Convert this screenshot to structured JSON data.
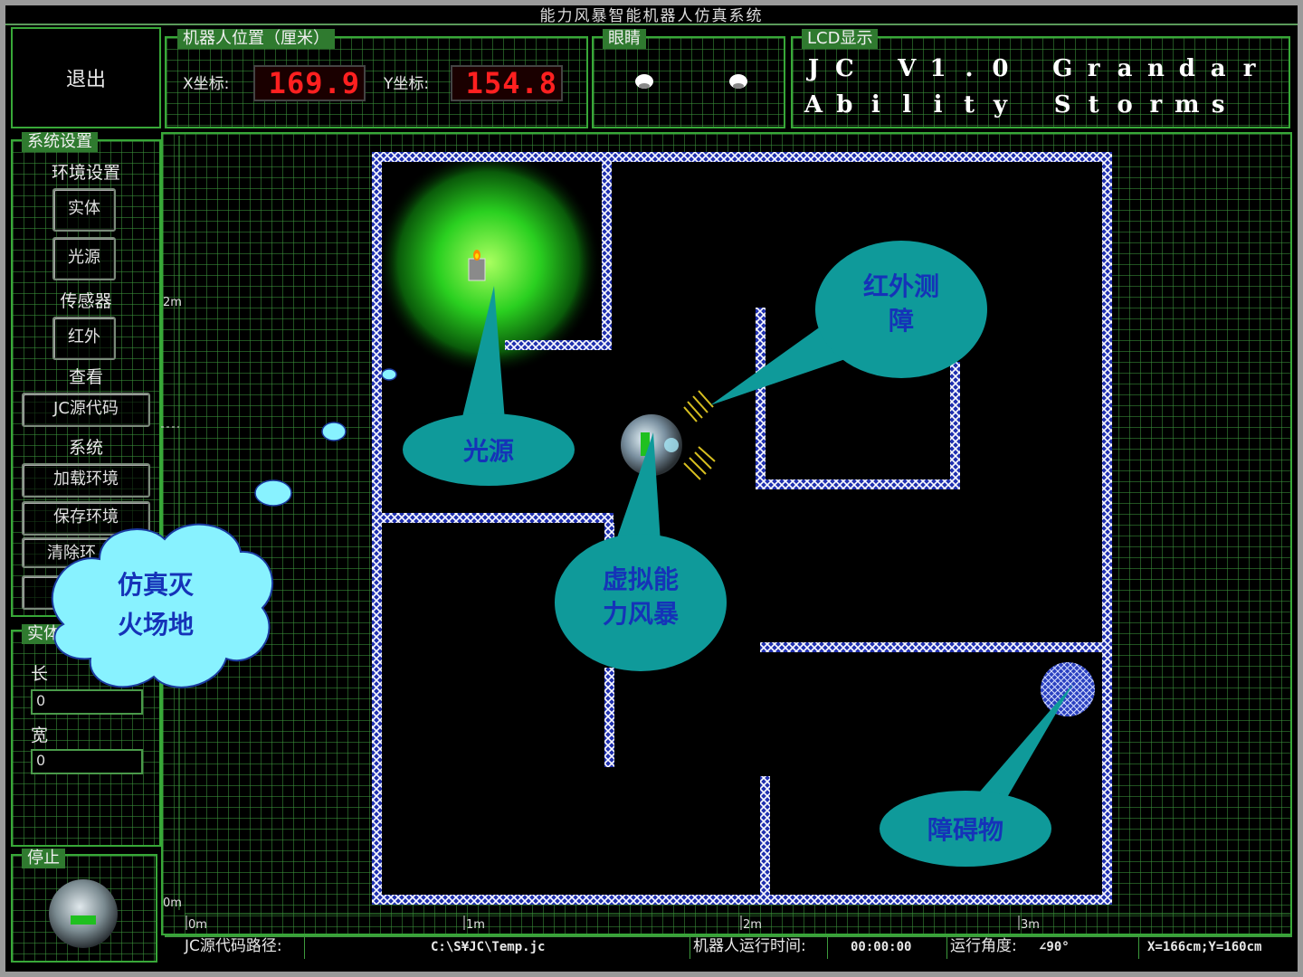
{
  "window": {
    "title": "能力风暴智能机器人仿真系统"
  },
  "exit_button": {
    "label": "退出"
  },
  "position_panel": {
    "label": "机器人位置（厘米）",
    "x_label": "X坐标:",
    "x_value": "169.9",
    "y_label": "Y坐标:",
    "y_value": "154.8"
  },
  "eyes_panel": {
    "label": "眼睛"
  },
  "lcd_panel": {
    "label": "LCD显示",
    "line1": [
      "J",
      "C",
      " ",
      "V",
      "1",
      ".",
      "0",
      " ",
      "G",
      "r",
      "a",
      "n",
      "d",
      "a",
      "r"
    ],
    "line2": [
      "A",
      "b",
      "i",
      "l",
      "i",
      "t",
      "y",
      " ",
      "S",
      "t",
      "o",
      "r",
      "m",
      "s"
    ]
  },
  "settings_panel": {
    "label": "系统设置",
    "env_heading": "环境设置",
    "btn_entity": "实体",
    "btn_light": "光源",
    "sensor_heading": "传感器",
    "btn_infrared": "红外",
    "view_heading": "查看",
    "btn_source": "JC源代码",
    "system_heading": "系统",
    "btn_load": "加载环境",
    "btn_save": "保存环境",
    "btn_clear": "清除环"
  },
  "entity_panel": {
    "label": "实体",
    "length_label": "长",
    "length_value": "0",
    "width_label": "宽",
    "width_value": "0"
  },
  "stop_panel": {
    "label": "停止"
  },
  "ruler": {
    "x_ticks": [
      "0m",
      "1m",
      "2m",
      "3m"
    ],
    "y_ticks": [
      "2m",
      "0m"
    ]
  },
  "status_bar": {
    "path_label": "JC源代码路径:",
    "path_value": "C:\\S¥JC\\Temp.jc",
    "runtime_label": "机器人运行时间:",
    "runtime_value": "00:00:00",
    "angle_label": "运行角度:",
    "angle_value": "∠90°",
    "coords_value": "X=166cm;Y=160cm"
  },
  "callouts": {
    "arena": [
      "仿真灭",
      "火场地"
    ],
    "light": "光源",
    "infrared": [
      "红外测",
      "障"
    ],
    "robot": [
      "虚拟能",
      "力风暴"
    ],
    "obstacle": "障碍物"
  },
  "colors": {
    "panel_green": "#2f7a2f",
    "grid_green": "#3c963c",
    "wall_blue": "#4a6cd8",
    "callout_teal": "#0f9a9a",
    "callout_text": "#1533b8",
    "cloud_fill": "#88f2ff",
    "led_red": "#ff2020"
  }
}
